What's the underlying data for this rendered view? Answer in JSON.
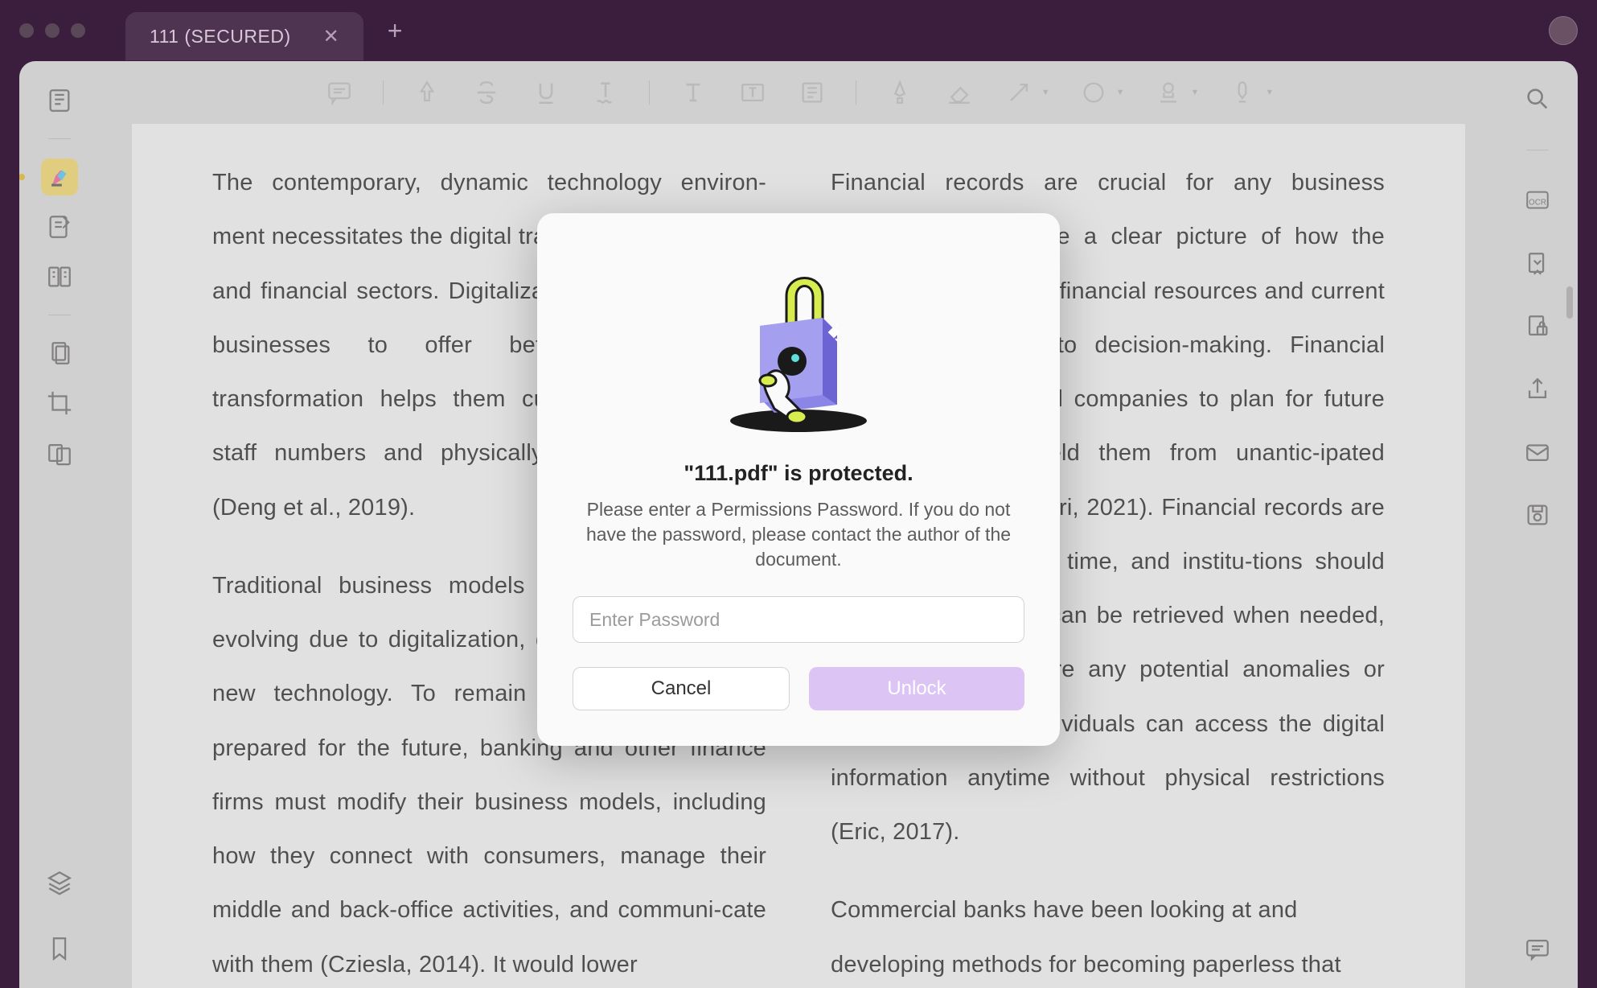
{
  "window": {
    "tab_title": "111 (SECURED)"
  },
  "dialog": {
    "title": "\"111.pdf\" is protected.",
    "message": "Please enter a Permissions Password. If you do not have the password, please contact the author of the document.",
    "placeholder": "Enter Password",
    "cancel": "Cancel",
    "unlock": "Unlock"
  },
  "right_sidebar": {
    "ocr_label": "OCR"
  },
  "document": {
    "left_col": {
      "p1": "The contemporary, dynamic technology environ-ment necessitates the digital transformation of banks and financial sectors. Digitalization enables banking businesses to offer better service. The transformation helps them cut expenses, reduce staff numbers and physically present customers (Deng et al., 2019).",
      "p2": "Traditional business models and procedures are evolving due to digitalization, digital disruption, and new technology. To remain competitive and be prepared for the future, banking and other finance firms must modify their business models, including how they connect with consumers, manage their middle and back-office activities, and communi-cate with them (Cziesla, 2014). It would lower"
    },
    "right_col": {
      "p1": "Financial records are crucial for any business because they provide a clear picture of how the company employs its financial resources and current activities, essential to decision-making. Financial records help financial companies to plan for future operations and shield them from unantic-ipated financial busts (Kumari, 2021). Financial records are important throughout time, and institu-tions should retain them so they can be retrieved when needed, especially if there are any potential anomalies or fraud. Authorized individuals can access the digital information anytime without physical restrictions (Eric, 2017).",
      "p2": "Commercial banks have been looking at and developing methods for becoming paperless that"
    }
  }
}
